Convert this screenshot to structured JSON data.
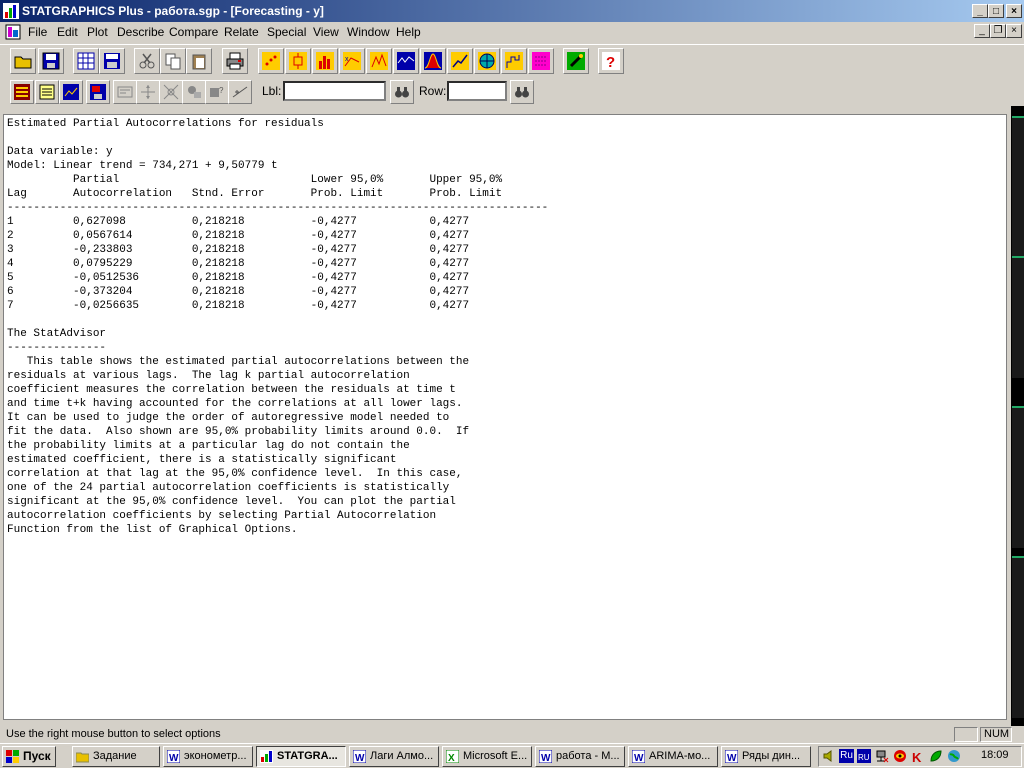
{
  "window": {
    "title": "STATGRAPHICS Plus - работа.sgp - [Forecasting - y]",
    "caption_buttons": [
      "_",
      "□",
      "×"
    ],
    "mdi_buttons": [
      "_",
      "❐",
      "×"
    ]
  },
  "menu": [
    "File",
    "Edit",
    "Plot",
    "Describe",
    "Compare",
    "Relate",
    "Special",
    "View",
    "Window",
    "Help"
  ],
  "toolbar2": {
    "lbl_label": "Lbl:",
    "lbl_value": "",
    "row_label": "Row:",
    "row_value": ""
  },
  "report": {
    "title": "Estimated Partial Autocorrelations for residuals",
    "data_variable": "Data variable: y",
    "model": "Model: Linear trend = 734,271 + 9,50779 t",
    "header1": "          Partial                             Lower 95,0%       Upper 95,0%",
    "header2": "Lag       Autocorrelation   Stnd. Error       Prob. Limit       Prob. Limit",
    "separator": "----------------------------------------------------------------------------------",
    "rows": [
      {
        "lag": "1",
        "pacf": "0,627098",
        "se": "0,218218",
        "lower": "-0,4277",
        "upper": "0,4277"
      },
      {
        "lag": "2",
        "pacf": "0,0567614",
        "se": "0,218218",
        "lower": "-0,4277",
        "upper": "0,4277"
      },
      {
        "lag": "3",
        "pacf": "-0,233803",
        "se": "0,218218",
        "lower": "-0,4277",
        "upper": "0,4277"
      },
      {
        "lag": "4",
        "pacf": "0,0795229",
        "se": "0,218218",
        "lower": "-0,4277",
        "upper": "0,4277"
      },
      {
        "lag": "5",
        "pacf": "-0,0512536",
        "se": "0,218218",
        "lower": "-0,4277",
        "upper": "0,4277"
      },
      {
        "lag": "6",
        "pacf": "-0,373204",
        "se": "0,218218",
        "lower": "-0,4277",
        "upper": "0,4277"
      },
      {
        "lag": "7",
        "pacf": "-0,0256635",
        "se": "0,218218",
        "lower": "-0,4277",
        "upper": "0,4277"
      }
    ],
    "advisor_title": "The StatAdvisor",
    "advisor_underline": "---------------",
    "advisor_text": [
      "   This table shows the estimated partial autocorrelations between the",
      "residuals at various lags.  The lag k partial autocorrelation",
      "coefficient measures the correlation between the residuals at time t",
      "and time t+k having accounted for the correlations at all lower lags.",
      "It can be used to judge the order of autoregressive model needed to",
      "fit the data.  Also shown are 95,0% probability limits around 0.0.  If",
      "the probability limits at a particular lag do not contain the",
      "estimated coefficient, there is a statistically significant",
      "correlation at that lag at the 95,0% confidence level.  In this case,",
      "one of the 24 partial autocorrelation coefficients is statistically",
      "significant at the 95,0% confidence level.  You can plot the partial",
      "autocorrelation coefficients by selecting Partial Autocorrelation",
      "Function from the list of Graphical Options."
    ]
  },
  "status": {
    "message": "Use the right mouse button to select options",
    "indicator": "NUM"
  },
  "taskbar": {
    "start": "Пуск",
    "tasks": [
      "Задание",
      "эконометр...",
      "STATGRA...",
      "Лаги Алмо...",
      "Microsoft E...",
      "работа - M...",
      "ARIMA-мо...",
      "Ряды дин..."
    ],
    "tray_lang": "Ru",
    "clock": "18:09"
  },
  "colors": {
    "titlebar_start": "#0a246a",
    "titlebar_end": "#a6caf0",
    "face": "#d4d0c8"
  }
}
